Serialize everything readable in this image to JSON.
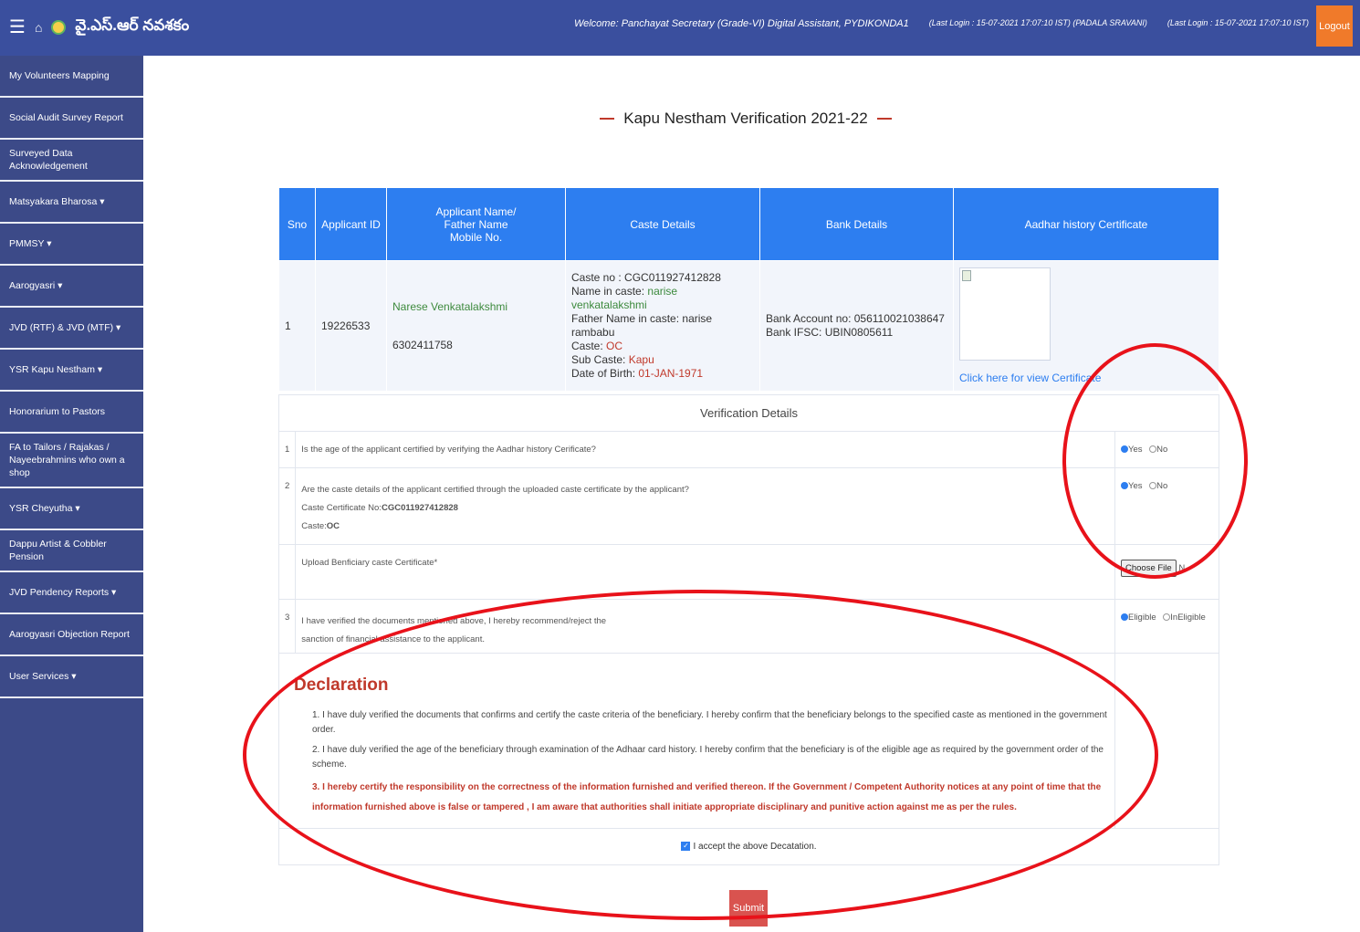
{
  "header": {
    "app_title": "వై.ఎస్.ఆర్ నవశకం",
    "welcome": "Welcome: Panchayat Secretary (Grade-VI) Digital Assistant, PYDIKONDA1",
    "last_login_1": "(Last Login : 15-07-2021 17:07:10 IST) (PADALA SRAVANI)",
    "last_login_2": "(Last Login : 15-07-2021 17:07:10 IST)",
    "logout": "Logout"
  },
  "sidebar": {
    "items": [
      {
        "label": "My Volunteers Mapping"
      },
      {
        "label": "Social Audit Survey Report"
      },
      {
        "label": "Surveyed Data Acknowledgement"
      },
      {
        "label": "Matsyakara Bharosa ▾"
      },
      {
        "label": "PMMSY ▾"
      },
      {
        "label": "Aarogyasri ▾"
      },
      {
        "label": "JVD (RTF) & JVD (MTF) ▾"
      },
      {
        "label": "YSR Kapu Nestham ▾"
      },
      {
        "label": "Honorarium to Pastors"
      },
      {
        "label": "FA to Tailors / Rajakas / Nayeebrahmins who own a shop"
      },
      {
        "label": "YSR Cheyutha ▾"
      },
      {
        "label": "Dappu Artist & Cobbler Pension"
      },
      {
        "label": "JVD Pendency Reports ▾"
      },
      {
        "label": "Aarogyasri Objection Report"
      },
      {
        "label": "User Services ▾"
      }
    ]
  },
  "page": {
    "title": "Kapu Nestham Verification 2021-22"
  },
  "table": {
    "headers": {
      "sno": "Sno",
      "applicant_id": "Applicant ID",
      "name_l1": "Applicant Name/",
      "name_l2": "Father Name",
      "name_l3": "Mobile No.",
      "caste": "Caste Details",
      "bank": "Bank Details",
      "aadhar": "Aadhar history Certificate"
    },
    "row": {
      "sno": "1",
      "applicant_id": "19226533",
      "name": "Narese Venkatalakshmi",
      "mobile": "6302411758",
      "caste_no_label": "Caste no :",
      "caste_no": "CGC011927412828",
      "name_in_caste_label": "Name in caste:",
      "name_in_caste": "narise venkatalakshmi",
      "father_in_caste_label": "Father Name in caste:",
      "father_in_caste": "narise rambabu",
      "caste_label": "Caste:",
      "caste": "OC",
      "sub_caste_label": "Sub Caste:",
      "sub_caste": "Kapu",
      "dob_label": "Date of Birth:",
      "dob": "01-JAN-1971",
      "bank_acc_label": "Bank Account no:",
      "bank_acc": "056110021038647",
      "ifsc_label": "Bank IFSC:",
      "ifsc": "UBIN0805611",
      "cert_link": "Click here for view Certificate"
    }
  },
  "verification": {
    "title": "Verification Details",
    "q1": {
      "num": "1",
      "text": "Is the age of the applicant certified by verifying the Aadhar history Cerificate?",
      "yes": "Yes",
      "no": "No"
    },
    "q2": {
      "num": "2",
      "text": "Are the caste details of the applicant certified through the uploaded caste certificate by the applicant?",
      "cert_label": "Caste Certificate No:",
      "cert_no": "CGC011927412828",
      "caste_label": "Caste:",
      "caste": "OC",
      "yes": "Yes",
      "no": "No"
    },
    "upload": {
      "label": "Upload Benficiary caste Certificate*",
      "button": "Choose File",
      "suffix": "N"
    },
    "q3": {
      "num": "3",
      "line1": "I have verified the documents mentioned above, I hereby recommend/reject the",
      "line2": "sanction of financial assistance to the applicant.",
      "eligible": "Eligible",
      "ineligible": "InEligible"
    }
  },
  "declaration": {
    "title": "Declaration",
    "items": [
      "1. I have duly verified the documents that confirms and certify the caste criteria of the beneficiary. I hereby confirm that the beneficiary belongs to the specified caste as mentioned in the government order.",
      "2. I have duly verified the age of the beneficiary through examination of the Adhaar card history. I hereby confirm that the beneficiary is of the eligible age as required by the government order of the scheme.",
      "3. I hereby certify the responsibility on the correctness of the information furnished and verified thereon. If the Government / Competent Authority notices at any point of time that the information furnished above is false or tampered , I am aware that authorities shall initiate appropriate disciplinary and punitive action against me as per the rules."
    ],
    "accept": "I accept the above Decatation."
  },
  "submit": "Submit",
  "colors": {
    "topbar": "#3a4f9e",
    "sidebar": "#3c4a88",
    "table_header": "#2d7ef0",
    "accent_red": "#c0392b",
    "annotation": "#e8121a",
    "logout": "#f07a2a"
  }
}
